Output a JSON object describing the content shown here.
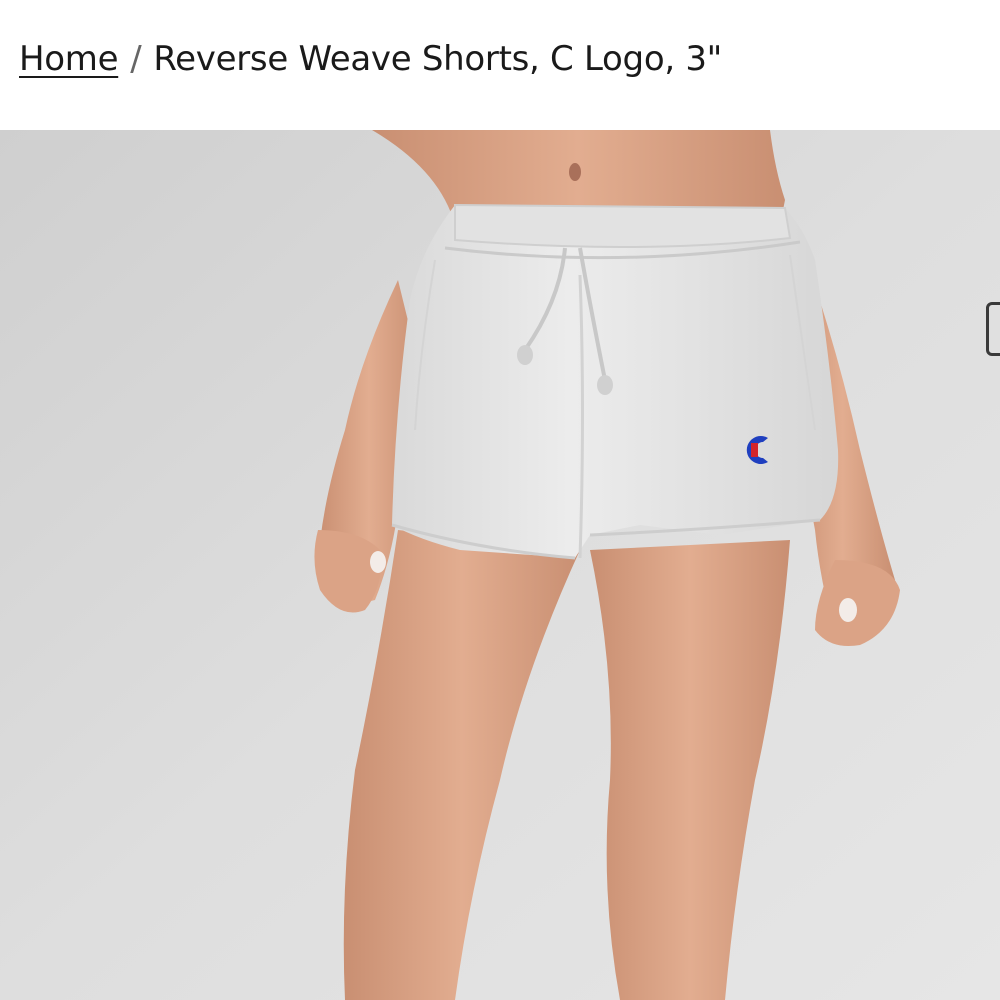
{
  "breadcrumb": {
    "home_label": "Home",
    "separator": "/",
    "current_label": "Reverse Weave Shorts, C Logo, 3\""
  },
  "product_image": {
    "alt": "Reverse Weave Shorts, C Logo, 3\"",
    "background_color": "#d9d9d9",
    "shorts_color": "#e8e8e8",
    "logo_colors": [
      "#1f3fbf",
      "#d3242b"
    ]
  },
  "icons": {
    "next_image": "chevron-right-icon"
  }
}
